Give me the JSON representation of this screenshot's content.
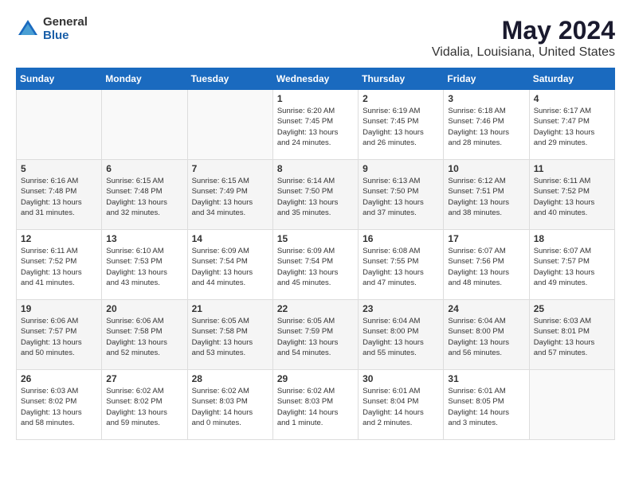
{
  "header": {
    "logo_general": "General",
    "logo_blue": "Blue",
    "main_title": "May 2024",
    "subtitle": "Vidalia, Louisiana, United States"
  },
  "days_of_week": [
    "Sunday",
    "Monday",
    "Tuesday",
    "Wednesday",
    "Thursday",
    "Friday",
    "Saturday"
  ],
  "weeks": [
    [
      {
        "day": "",
        "content": ""
      },
      {
        "day": "",
        "content": ""
      },
      {
        "day": "",
        "content": ""
      },
      {
        "day": "1",
        "content": "Sunrise: 6:20 AM\nSunset: 7:45 PM\nDaylight: 13 hours\nand 24 minutes."
      },
      {
        "day": "2",
        "content": "Sunrise: 6:19 AM\nSunset: 7:45 PM\nDaylight: 13 hours\nand 26 minutes."
      },
      {
        "day": "3",
        "content": "Sunrise: 6:18 AM\nSunset: 7:46 PM\nDaylight: 13 hours\nand 28 minutes."
      },
      {
        "day": "4",
        "content": "Sunrise: 6:17 AM\nSunset: 7:47 PM\nDaylight: 13 hours\nand 29 minutes."
      }
    ],
    [
      {
        "day": "5",
        "content": "Sunrise: 6:16 AM\nSunset: 7:48 PM\nDaylight: 13 hours\nand 31 minutes."
      },
      {
        "day": "6",
        "content": "Sunrise: 6:15 AM\nSunset: 7:48 PM\nDaylight: 13 hours\nand 32 minutes."
      },
      {
        "day": "7",
        "content": "Sunrise: 6:15 AM\nSunset: 7:49 PM\nDaylight: 13 hours\nand 34 minutes."
      },
      {
        "day": "8",
        "content": "Sunrise: 6:14 AM\nSunset: 7:50 PM\nDaylight: 13 hours\nand 35 minutes."
      },
      {
        "day": "9",
        "content": "Sunrise: 6:13 AM\nSunset: 7:50 PM\nDaylight: 13 hours\nand 37 minutes."
      },
      {
        "day": "10",
        "content": "Sunrise: 6:12 AM\nSunset: 7:51 PM\nDaylight: 13 hours\nand 38 minutes."
      },
      {
        "day": "11",
        "content": "Sunrise: 6:11 AM\nSunset: 7:52 PM\nDaylight: 13 hours\nand 40 minutes."
      }
    ],
    [
      {
        "day": "12",
        "content": "Sunrise: 6:11 AM\nSunset: 7:52 PM\nDaylight: 13 hours\nand 41 minutes."
      },
      {
        "day": "13",
        "content": "Sunrise: 6:10 AM\nSunset: 7:53 PM\nDaylight: 13 hours\nand 43 minutes."
      },
      {
        "day": "14",
        "content": "Sunrise: 6:09 AM\nSunset: 7:54 PM\nDaylight: 13 hours\nand 44 minutes."
      },
      {
        "day": "15",
        "content": "Sunrise: 6:09 AM\nSunset: 7:54 PM\nDaylight: 13 hours\nand 45 minutes."
      },
      {
        "day": "16",
        "content": "Sunrise: 6:08 AM\nSunset: 7:55 PM\nDaylight: 13 hours\nand 47 minutes."
      },
      {
        "day": "17",
        "content": "Sunrise: 6:07 AM\nSunset: 7:56 PM\nDaylight: 13 hours\nand 48 minutes."
      },
      {
        "day": "18",
        "content": "Sunrise: 6:07 AM\nSunset: 7:57 PM\nDaylight: 13 hours\nand 49 minutes."
      }
    ],
    [
      {
        "day": "19",
        "content": "Sunrise: 6:06 AM\nSunset: 7:57 PM\nDaylight: 13 hours\nand 50 minutes."
      },
      {
        "day": "20",
        "content": "Sunrise: 6:06 AM\nSunset: 7:58 PM\nDaylight: 13 hours\nand 52 minutes."
      },
      {
        "day": "21",
        "content": "Sunrise: 6:05 AM\nSunset: 7:58 PM\nDaylight: 13 hours\nand 53 minutes."
      },
      {
        "day": "22",
        "content": "Sunrise: 6:05 AM\nSunset: 7:59 PM\nDaylight: 13 hours\nand 54 minutes."
      },
      {
        "day": "23",
        "content": "Sunrise: 6:04 AM\nSunset: 8:00 PM\nDaylight: 13 hours\nand 55 minutes."
      },
      {
        "day": "24",
        "content": "Sunrise: 6:04 AM\nSunset: 8:00 PM\nDaylight: 13 hours\nand 56 minutes."
      },
      {
        "day": "25",
        "content": "Sunrise: 6:03 AM\nSunset: 8:01 PM\nDaylight: 13 hours\nand 57 minutes."
      }
    ],
    [
      {
        "day": "26",
        "content": "Sunrise: 6:03 AM\nSunset: 8:02 PM\nDaylight: 13 hours\nand 58 minutes."
      },
      {
        "day": "27",
        "content": "Sunrise: 6:02 AM\nSunset: 8:02 PM\nDaylight: 13 hours\nand 59 minutes."
      },
      {
        "day": "28",
        "content": "Sunrise: 6:02 AM\nSunset: 8:03 PM\nDaylight: 14 hours\nand 0 minutes."
      },
      {
        "day": "29",
        "content": "Sunrise: 6:02 AM\nSunset: 8:03 PM\nDaylight: 14 hours\nand 1 minute."
      },
      {
        "day": "30",
        "content": "Sunrise: 6:01 AM\nSunset: 8:04 PM\nDaylight: 14 hours\nand 2 minutes."
      },
      {
        "day": "31",
        "content": "Sunrise: 6:01 AM\nSunset: 8:05 PM\nDaylight: 14 hours\nand 3 minutes."
      },
      {
        "day": "",
        "content": ""
      }
    ]
  ]
}
